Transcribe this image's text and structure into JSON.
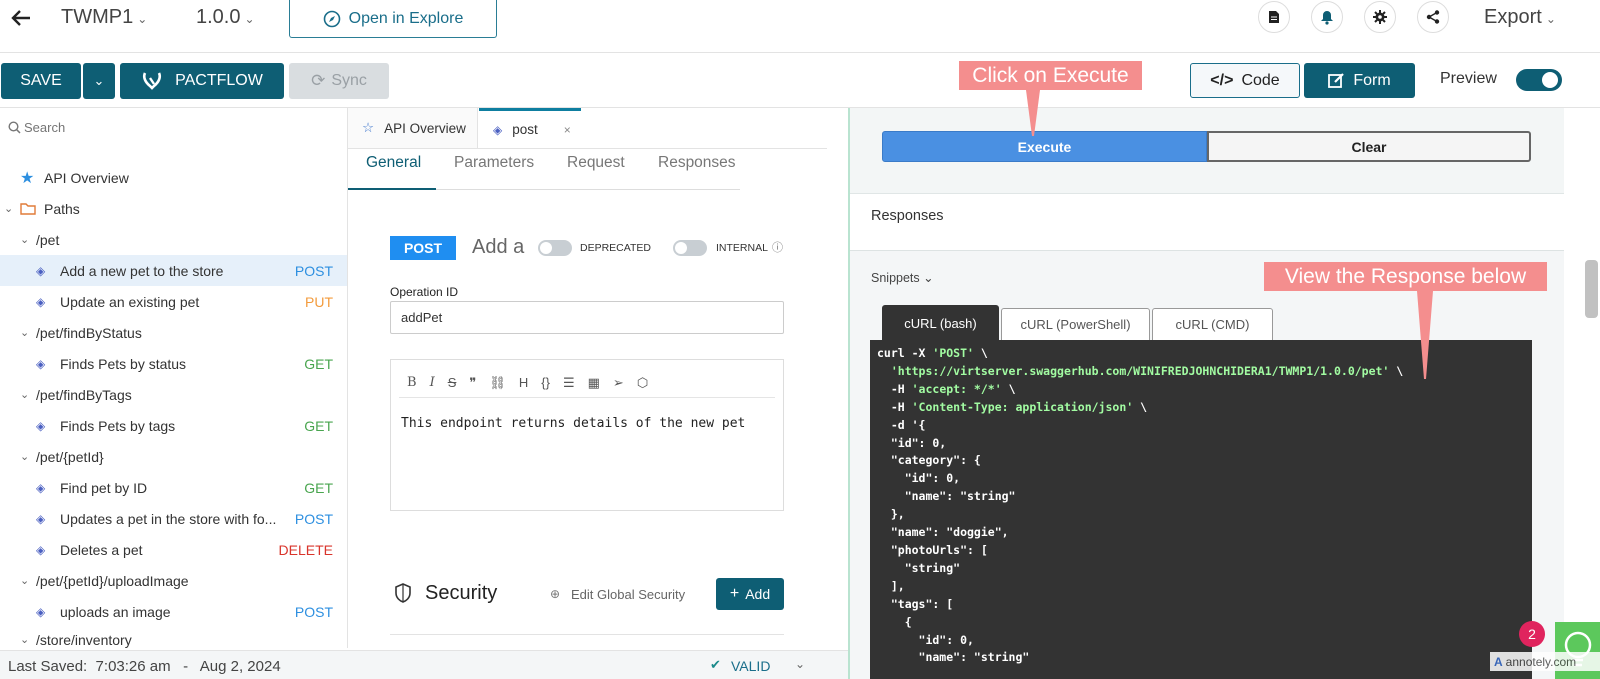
{
  "topbar": {
    "api_name": "TWMP1",
    "version": "1.0.0",
    "open_explore": "Open in Explore",
    "export": "Export"
  },
  "toolbar": {
    "save": "SAVE",
    "pactflow": "PACTFLOW",
    "sync": "Sync",
    "code": "Code",
    "form": "Form",
    "preview": "Preview",
    "preview_on": true
  },
  "sidebar": {
    "search_placeholder": "Search",
    "items": [
      {
        "label": "API Overview"
      },
      {
        "label": "Paths"
      },
      {
        "label": "/pet"
      },
      {
        "label": "Add a new pet to the store",
        "method": "POST"
      },
      {
        "label": "Update an existing pet",
        "method": "PUT"
      },
      {
        "label": "/pet/findByStatus"
      },
      {
        "label": "Finds Pets by status",
        "method": "GET"
      },
      {
        "label": "/pet/findByTags"
      },
      {
        "label": "Finds Pets by tags",
        "method": "GET"
      },
      {
        "label": "/pet/{petId}"
      },
      {
        "label": "Find pet by ID",
        "method": "GET"
      },
      {
        "label": "Updates a pet in the store with fo...",
        "method": "POST"
      },
      {
        "label": "Deletes a pet",
        "method": "DELETE"
      },
      {
        "label": "/pet/{petId}/uploadImage"
      },
      {
        "label": "uploads an image",
        "method": "POST"
      },
      {
        "label": "/store/inventory"
      }
    ]
  },
  "editor": {
    "tabs": [
      "API Overview",
      "post"
    ],
    "sub_tabs": [
      "General",
      "Parameters",
      "Request",
      "Responses"
    ],
    "method_badge": "POST",
    "summary_partial": "Add a",
    "deprecated": "DEPRECATED",
    "internal": "INTERNAL",
    "operation_id_label": "Operation ID",
    "operation_id": "addPet",
    "description": "This endpoint returns details of the new pet",
    "security_title": "Security",
    "edit_global_security": "Edit Global Security",
    "add": "Add"
  },
  "preview": {
    "execute": "Execute",
    "clear": "Clear",
    "responses_title": "Responses",
    "snippets": "Snippets",
    "snippet_tabs": [
      "cURL (bash)",
      "cURL (PowerShell)",
      "cURL (CMD)"
    ],
    "code_lines": [
      "curl -X 'POST' \\",
      "  'https://virtserver.swaggerhub.com/WINIFREDJOHNCHIDERA1/TWMP1/1.0.0/pet' \\",
      "  -H 'accept: */*' \\",
      "  -H 'Content-Type: application/json' \\",
      "  -d '{",
      "  \"id\": 0,",
      "  \"category\": {",
      "    \"id\": 0,",
      "    \"name\": \"string\"",
      "  },",
      "  \"name\": \"doggie\",",
      "  \"photoUrls\": [",
      "    \"string\"",
      "  ],",
      "  \"tags\": [",
      "    {",
      "      \"id\": 0,",
      "      \"name\": \"string\""
    ]
  },
  "annotations": {
    "click_execute": "Click on Execute",
    "view_response": "View the Response below"
  },
  "footer": {
    "last_saved": "Last Saved:  7:03:26 am   -   Aug 2, 2024",
    "valid": "VALID"
  },
  "widget": {
    "badge_count": "2",
    "brand": "annotely.com"
  },
  "colors": {
    "primary": "#0e5e74",
    "execute_blue": "#4a90e2",
    "annotation": "#f48e8e"
  }
}
